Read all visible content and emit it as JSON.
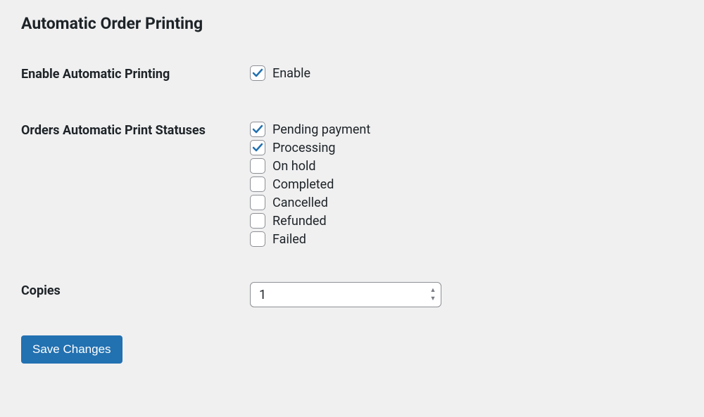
{
  "title": "Automatic Order Printing",
  "enable": {
    "label": "Enable Automatic Printing",
    "option_label": "Enable",
    "checked": true
  },
  "statuses": {
    "label": "Orders Automatic Print Statuses",
    "items": [
      {
        "label": "Pending payment",
        "checked": true
      },
      {
        "label": "Processing",
        "checked": true
      },
      {
        "label": "On hold",
        "checked": false
      },
      {
        "label": "Completed",
        "checked": false
      },
      {
        "label": "Cancelled",
        "checked": false
      },
      {
        "label": "Refunded",
        "checked": false
      },
      {
        "label": "Failed",
        "checked": false
      }
    ]
  },
  "copies": {
    "label": "Copies",
    "value": "1"
  },
  "save_label": "Save Changes"
}
